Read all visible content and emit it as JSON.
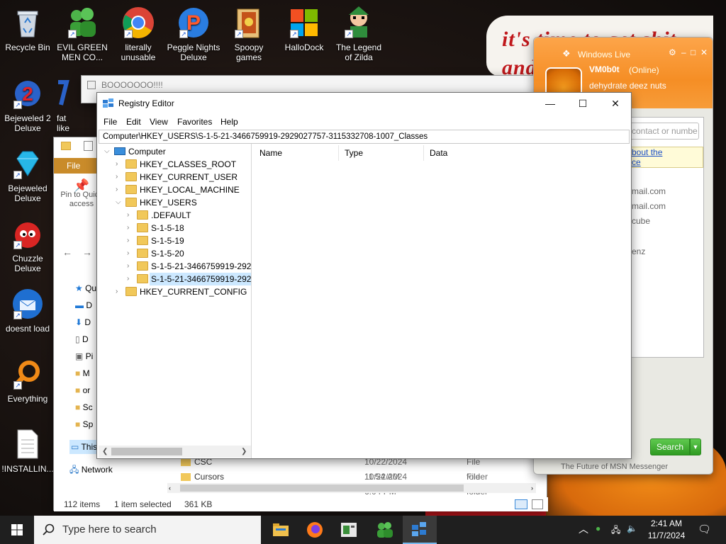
{
  "desktop": {
    "tagline": [
      "it's time to get shit",
      "and"
    ],
    "icons": [
      {
        "label": "Recycle Bin",
        "icon": "recycle-bin-icon"
      },
      {
        "label": "EVIL GREEN MEN CO...",
        "icon": "green-men-icon"
      },
      {
        "label": "literally unusable",
        "icon": "chrome-icon"
      },
      {
        "label": "Peggle Nights Deluxe",
        "icon": "peggle-icon"
      },
      {
        "label": "Spoopy games",
        "icon": "folder-icon"
      },
      {
        "label": "HalloDock",
        "icon": "windows-logo-icon"
      },
      {
        "label": "The Legend of Zilda",
        "icon": "zilda-icon"
      },
      {
        "label": "Bejeweled 2 Deluxe",
        "icon": "bejeweled-2-icon"
      },
      {
        "label": "fat like",
        "icon": "fat-like-icon"
      },
      {
        "label": "Bejeweled Deluxe",
        "icon": "diamond-icon"
      },
      {
        "label": "Chuzzle Deluxe",
        "icon": "chuzzle-icon"
      },
      {
        "label": "doesnt load",
        "icon": "thunderbird-icon"
      },
      {
        "label": "Everything",
        "icon": "everything-search-icon"
      },
      {
        "label": "!INSTALLIN...",
        "icon": "text-file-icon"
      }
    ]
  },
  "boo_window": {
    "title": "BOOOOOOO!!!!"
  },
  "explorer": {
    "ribbon_tab": "File",
    "pin_label": "Pin to Quick access",
    "nav_items": [
      "Qui",
      "D",
      "D",
      "D",
      "Pi",
      "M",
      "or",
      "Sc",
      "Sp",
      "This",
      "Network"
    ],
    "rows": [
      {
        "name": "CSC",
        "date": "10/22/2024 11:54 AM",
        "type": "File folder"
      },
      {
        "name": "Cursors",
        "date": "10/22/2024 6:04 PM",
        "type": "File folder"
      }
    ],
    "status": {
      "items": "112 items",
      "selected": "1 item selected",
      "size": "361 KB"
    }
  },
  "messenger": {
    "window_title": "Windows Live",
    "user_name": "VM0b0t",
    "user_status": "(Online)",
    "personal_message": "dehydrate deez nuts",
    "search_placeholder": "contact or numbe",
    "ad_text": [
      "bout the",
      "ce"
    ],
    "contacts": [
      "mail.com",
      "mail.com",
      "cube",
      "enz"
    ],
    "search_button": "Search",
    "footer": "The Future of MSN Messenger"
  },
  "regedit": {
    "title": "Registry Editor",
    "menu": [
      "File",
      "Edit",
      "View",
      "Favorites",
      "Help"
    ],
    "address": "Computer\\HKEY_USERS\\S-1-5-21-3466759919-2929027757-3115332708-1007_Classes",
    "tree": {
      "root": "Computer",
      "hives": [
        "HKEY_CLASSES_ROOT",
        "HKEY_CURRENT_USER",
        "HKEY_LOCAL_MACHINE",
        "HKEY_USERS"
      ],
      "users_children": [
        ".DEFAULT",
        "S-1-5-18",
        "S-1-5-19",
        "S-1-5-20",
        "S-1-5-21-3466759919-2929",
        "S-1-5-21-3466759919-2929"
      ],
      "last_hive": "HKEY_CURRENT_CONFIG"
    },
    "columns": [
      "Name",
      "Type",
      "Data"
    ]
  },
  "taskbar": {
    "search_placeholder": "Type here to search",
    "apps": [
      "file-explorer-icon",
      "firefox-icon",
      "task-app-icon",
      "messenger-icon",
      "regedit-icon"
    ],
    "time": "2:41 AM",
    "date": "11/7/2024"
  },
  "colors": {
    "taskbar": "#1f1f1f",
    "msn_orange": "#f58e25",
    "selection": "#cce8ff",
    "folder": "#f1c85a"
  }
}
